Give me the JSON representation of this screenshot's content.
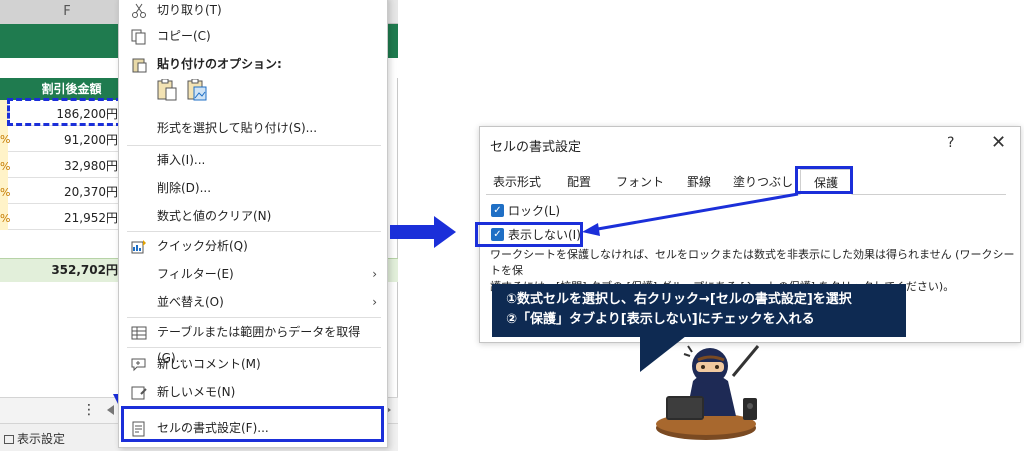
{
  "sheet": {
    "column_letter": "F",
    "header_cell": "割引後金額",
    "pct_marks": [
      "%",
      "%",
      "%",
      "%"
    ],
    "values": [
      "186,200円",
      "91,200円",
      "32,980円",
      "20,370円",
      "21,952円"
    ],
    "total": "352,702円",
    "sheet_tab": "表示設定",
    "more": "⋮"
  },
  "context_menu": {
    "items": {
      "cut": "切り取り(T)",
      "copy": "コピー(C)",
      "paste_options": "貼り付けのオプション:",
      "paste_special": "形式を選択して貼り付け(S)...",
      "insert": "挿入(I)...",
      "delete": "削除(D)...",
      "clear": "数式と値のクリア(N)",
      "quick_analysis": "クイック分析(Q)",
      "filter": "フィルター(E)",
      "sort": "並べ替え(O)",
      "get_data": "テーブルまたは範囲からデータを取得(G)...",
      "new_comment": "新しいコメント(M)",
      "new_note": "新しいメモ(N)",
      "format_cells": "セルの書式設定(F)..."
    },
    "submenu_arrow": "›"
  },
  "dialog": {
    "title": "セルの書式設定",
    "help": "?",
    "close": "✕",
    "tabs": [
      "表示形式",
      "配置",
      "フォント",
      "罫線",
      "塗りつぶし",
      "保護"
    ],
    "active_tab": "保護",
    "lock_label": "ロック(L)",
    "hidden_label": "表示しない(I)",
    "lock_checked": true,
    "hidden_checked": true,
    "description_line1": "ワークシートを保護しなければ、セルをロックまたは数式を非表示にした効果は得られません (ワークシートを保",
    "description_line2": "護するには、[校閲] タブの [保護] グループにある [シートの保護] をクリックしてください)。"
  },
  "callout": {
    "line1": "①数式セルを選択し、右クリック→[セルの書式設定]を選択",
    "line2": "②「保護」タブより[表示しない]にチェックを入れる"
  },
  "colors": {
    "excel_green": "#1f7b4f",
    "highlight_blue": "#1b2fd9",
    "callout_navy": "#0e2a52",
    "checkbox_blue": "#1f6fc5"
  }
}
